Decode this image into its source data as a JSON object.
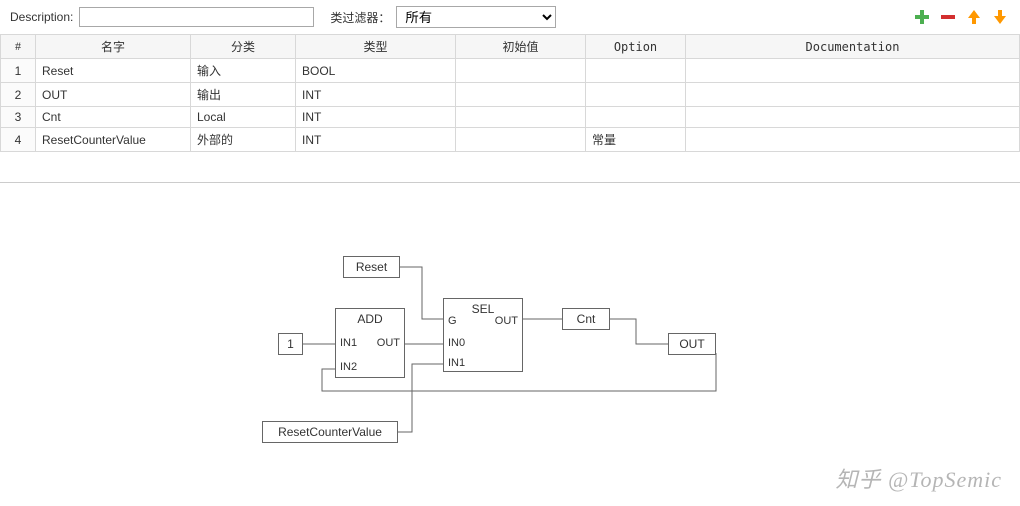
{
  "toolbar": {
    "description_label": "Description:",
    "description_value": "",
    "filter_label": "类过滤器：",
    "filter_selected": "所有"
  },
  "icon_names": {
    "add": "add-icon",
    "remove": "remove-icon",
    "up": "arrow-up-icon",
    "down": "arrow-down-icon"
  },
  "table": {
    "headers": {
      "num": "#",
      "name": "名字",
      "category": "分类",
      "type": "类型",
      "initial": "初始值",
      "option": "Option",
      "doc": "Documentation"
    },
    "rows": [
      {
        "num": "1",
        "name": "Reset",
        "category": "输入",
        "type": "BOOL",
        "initial": "",
        "option": "",
        "doc": ""
      },
      {
        "num": "2",
        "name": "OUT",
        "category": "输出",
        "type": "INT",
        "initial": "",
        "option": "",
        "doc": ""
      },
      {
        "num": "3",
        "name": "Cnt",
        "category": "Local",
        "type": "INT",
        "initial": "",
        "option": "",
        "doc": ""
      },
      {
        "num": "4",
        "name": "ResetCounterValue",
        "category": "外部的",
        "type": "INT",
        "initial": "",
        "option": "常量",
        "doc": ""
      }
    ]
  },
  "diagram": {
    "const_one": "1",
    "reset_box": "Reset",
    "rcv_box": "ResetCounterValue",
    "cnt_box": "Cnt",
    "out_box": "OUT",
    "add_block": {
      "title": "ADD",
      "ports": {
        "in1": "IN1",
        "in2": "IN2",
        "out": "OUT"
      }
    },
    "sel_block": {
      "title": "SEL",
      "ports": {
        "g": "G",
        "in0": "IN0",
        "in1": "IN1",
        "out": "OUT"
      }
    }
  },
  "watermark": "知乎 @TopSemic"
}
